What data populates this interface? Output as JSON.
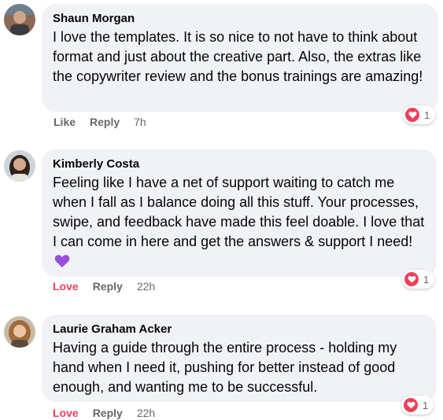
{
  "comments": [
    {
      "author": "Shaun Morgan",
      "text": "I love the templates. It is so nice to not have to think about format and just about the creative part. Also, the extras like the copywriter review and the bonus trainings are amazing!",
      "action_like": "Like",
      "action_reply": "Reply",
      "time": "7h",
      "reaction_count": "1"
    },
    {
      "author": "Kimberly Costa",
      "text": "Feeling like I have a net of support waiting to catch me when I fall as I balance doing all this stuff. Your processes, swipe, and feedback have made this feel doable. I love that I can come in here and get the answers & support I need!",
      "action_like": "Love",
      "action_reply": "Reply",
      "time": "22h",
      "reaction_count": "1"
    },
    {
      "author": "Laurie Graham Acker",
      "text": "Having a guide through the entire process - holding my hand when I need it, pushing for better instead of good enough, and wanting me to be successful.",
      "action_like": "Love",
      "action_reply": "Reply",
      "time": "22h",
      "reaction_count": "1"
    }
  ],
  "colors": {
    "bubble": "#f0f2f5",
    "love": "#f33e58",
    "meta": "#65676b",
    "purple_heart": "#9b4de0"
  },
  "icons": {
    "reaction": "heart-reaction-icon",
    "emoji": "purple-heart-emoji"
  }
}
